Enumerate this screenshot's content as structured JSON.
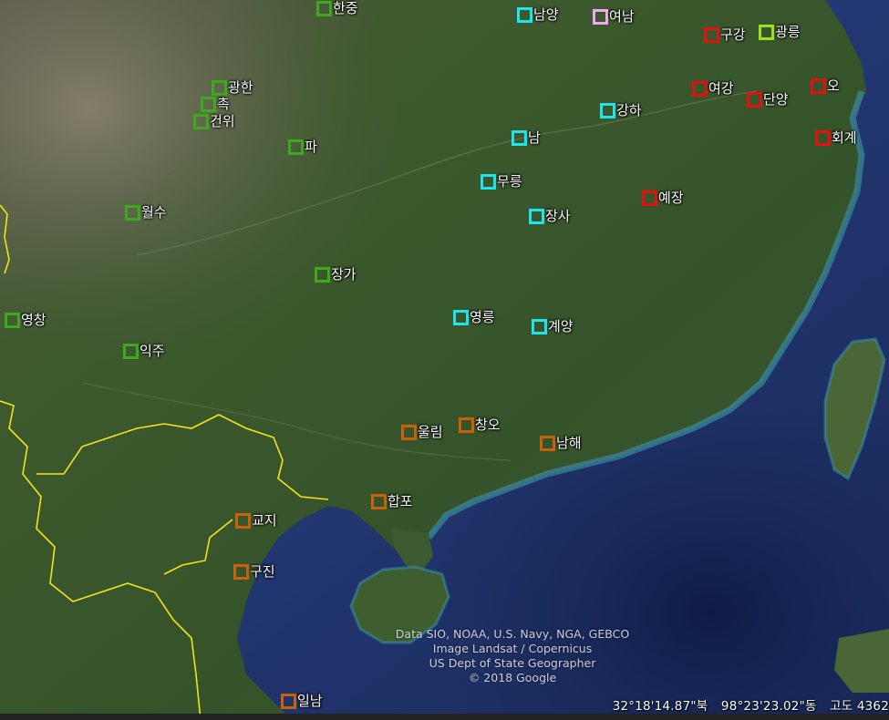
{
  "colors": {
    "group_green": "#3ea81e",
    "group_lime": "#9be21c",
    "group_cyan": "#1ee4ee",
    "group_pink": "#f0a8f0",
    "group_red": "#e41010",
    "group_orange": "#c8600c",
    "border_yellow": "#f2e41c",
    "ocean": "#22366c",
    "land": "#3c5a2c"
  },
  "markers": [
    {
      "label": "한중",
      "group": "group_green",
      "icon": "square-placemark-icon"
    },
    {
      "label": "광한",
      "group": "group_green",
      "icon": "square-placemark-icon"
    },
    {
      "label": "촉",
      "group": "group_green",
      "icon": "square-placemark-icon"
    },
    {
      "label": "건위",
      "group": "group_green",
      "icon": "square-placemark-icon"
    },
    {
      "label": "파",
      "group": "group_green",
      "icon": "square-placemark-icon"
    },
    {
      "label": "월수",
      "group": "group_green",
      "icon": "square-placemark-icon"
    },
    {
      "label": "장가",
      "group": "group_green",
      "icon": "square-placemark-icon"
    },
    {
      "label": "영창",
      "group": "group_green",
      "icon": "square-placemark-icon"
    },
    {
      "label": "익주",
      "group": "group_green",
      "icon": "square-placemark-icon"
    },
    {
      "label": "남양",
      "group": "group_cyan",
      "icon": "square-placemark-icon"
    },
    {
      "label": "여남",
      "group": "group_pink",
      "icon": "square-placemark-icon"
    },
    {
      "label": "구강",
      "group": "group_red",
      "icon": "square-placemark-icon"
    },
    {
      "label": "광릉",
      "group": "group_lime",
      "icon": "square-placemark-icon"
    },
    {
      "label": "여강",
      "group": "group_red",
      "icon": "square-placemark-icon"
    },
    {
      "label": "단양",
      "group": "group_red",
      "icon": "square-placemark-icon"
    },
    {
      "label": "오",
      "group": "group_red",
      "icon": "square-placemark-icon"
    },
    {
      "label": "강하",
      "group": "group_cyan",
      "icon": "square-placemark-icon"
    },
    {
      "label": "남",
      "group": "group_cyan",
      "icon": "square-placemark-icon"
    },
    {
      "label": "회계",
      "group": "group_red",
      "icon": "square-placemark-icon"
    },
    {
      "label": "무릉",
      "group": "group_cyan",
      "icon": "square-placemark-icon"
    },
    {
      "label": "예장",
      "group": "group_red",
      "icon": "square-placemark-icon"
    },
    {
      "label": "장사",
      "group": "group_cyan",
      "icon": "square-placemark-icon"
    },
    {
      "label": "영릉",
      "group": "group_cyan",
      "icon": "square-placemark-icon"
    },
    {
      "label": "계양",
      "group": "group_cyan",
      "icon": "square-placemark-icon"
    },
    {
      "label": "울림",
      "group": "group_orange",
      "icon": "square-placemark-icon"
    },
    {
      "label": "창오",
      "group": "group_orange",
      "icon": "square-placemark-icon"
    },
    {
      "label": "남해",
      "group": "group_orange",
      "icon": "square-placemark-icon"
    },
    {
      "label": "합포",
      "group": "group_orange",
      "icon": "square-placemark-icon"
    },
    {
      "label": "교지",
      "group": "group_orange",
      "icon": "square-placemark-icon"
    },
    {
      "label": "구진",
      "group": "group_orange",
      "icon": "square-placemark-icon"
    },
    {
      "label": "일남",
      "group": "group_orange",
      "icon": "square-placemark-icon"
    }
  ],
  "attribution": {
    "line1": "Data SIO, NOAA, U.S. Navy, NGA, GEBCO",
    "line2": "Image Landsat / Copernicus",
    "line3": "US Dept of State Geographer",
    "line4": "© 2018 Google"
  },
  "status": {
    "lat": "32°18'14.87\"북",
    "lon": "98°23'23.02\"동",
    "alt": "고도  4362"
  }
}
